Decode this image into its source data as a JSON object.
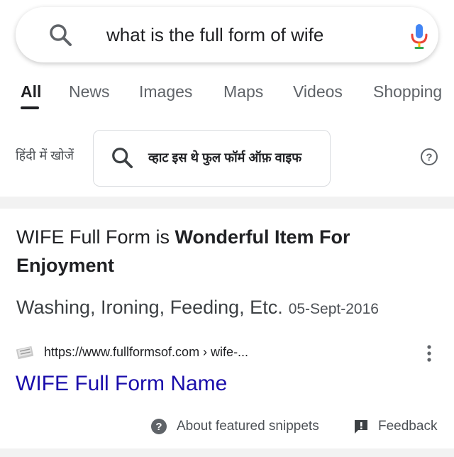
{
  "search": {
    "query": "what is the full form of wife"
  },
  "tabs": [
    {
      "label": "All",
      "active": true
    },
    {
      "label": "News"
    },
    {
      "label": "Images"
    },
    {
      "label": "Maps"
    },
    {
      "label": "Videos"
    },
    {
      "label": "Shopping"
    }
  ],
  "hindi": {
    "label": "हिंदी में खोजें",
    "query": "व्हाट इस थे फुल फॉर्म ऑफ़ वाइफ"
  },
  "snippet": {
    "title_prefix": "WIFE Full Form is ",
    "title_bold": "Wonderful Item For Enjoyment",
    "body": "Washing, Ironing, Feeding, Etc.",
    "date": "05-Sept-2016",
    "source_url": "https://www.fullformsof.com › wife-...",
    "link_title": "WIFE Full Form Name",
    "about_label": "About featured snippets",
    "feedback_label": "Feedback"
  },
  "icons": {
    "search": "search-icon",
    "mic": "microphone-icon",
    "help": "help-circle-icon",
    "favicon": "site-favicon",
    "more": "more-vertical-icon",
    "about": "question-circle-icon",
    "feedback": "feedback-icon"
  },
  "colors": {
    "link": "#1a0dab",
    "mic_blue": "#4285f4",
    "mic_red": "#ea4335",
    "mic_yellow": "#fbbc05",
    "mic_green": "#34a853"
  }
}
